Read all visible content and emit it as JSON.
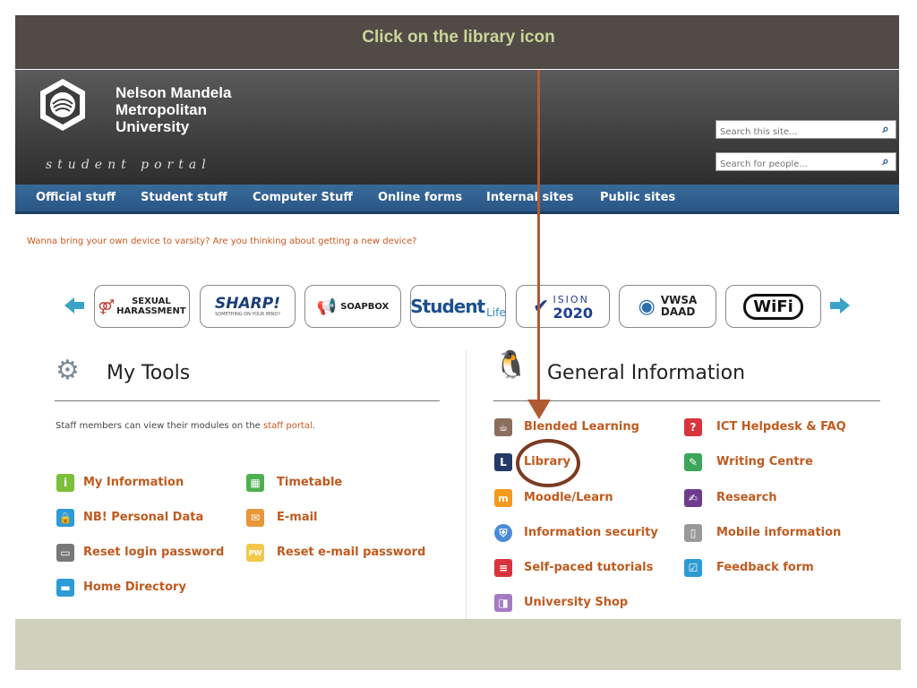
{
  "slide": {
    "instruction": "Click on the library icon",
    "accent_color": "#b05a33"
  },
  "header": {
    "university_name": [
      "Nelson Mandela",
      "Metropolitan",
      "University"
    ],
    "portal_label": "student portal",
    "search_site_placeholder": "Search this site...",
    "search_people_placeholder": "Search for people..."
  },
  "nav": {
    "items": [
      "Official stuff",
      "Student stuff",
      "Computer Stuff",
      "Online forms",
      "Internal sites",
      "Public sites"
    ]
  },
  "promo_text": "Wanna bring your own device to varsity? Are you thinking about getting a new device?",
  "banners": [
    {
      "label": "SEXUAL HARASSMENT",
      "line1": "SEXUAL",
      "line2": "HARASSMENT"
    },
    {
      "label": "SHARP!",
      "line1": "SHARP!",
      "line2": "SOMETHING ON YOUR MIND?"
    },
    {
      "label": "SOAPBOX",
      "line1": "SOAPBOX"
    },
    {
      "label": "Student Life",
      "line1": "Student",
      "line2": "Life"
    },
    {
      "label": "VISION 2020",
      "line1": "ISION",
      "line2": "2020"
    },
    {
      "label": "VWSA DAAD",
      "line1": "VWSA",
      "line2": "DAAD"
    },
    {
      "label": "WiFi",
      "line1": "WiFi"
    }
  ],
  "my_tools": {
    "title": "My Tools",
    "note_prefix": "Staff members can view their modules on the ",
    "note_link": "staff portal",
    "note_suffix": ".",
    "links": [
      {
        "label": "My Information",
        "icon": "info-icon"
      },
      {
        "label": "Timetable",
        "icon": "timetable-icon"
      },
      {
        "label": "NB! Personal Data",
        "icon": "lock-icon"
      },
      {
        "label": "E-mail",
        "icon": "envelope-icon"
      },
      {
        "label": "Reset login password",
        "icon": "monitor-icon"
      },
      {
        "label": "Reset e-mail password",
        "icon": "pw-envelope-icon"
      },
      {
        "label": "Home Directory",
        "icon": "folder-icon"
      }
    ]
  },
  "general_info": {
    "title": "General Information",
    "links": [
      {
        "label": "Blended Learning",
        "icon": "coffee-cup-icon"
      },
      {
        "label": "ICT Helpdesk & FAQ",
        "icon": "question-icon"
      },
      {
        "label": "Library",
        "icon": "library-icon"
      },
      {
        "label": "Writing Centre",
        "icon": "pencil-icon"
      },
      {
        "label": "Moodle/Learn",
        "icon": "moodle-icon"
      },
      {
        "label": "Research",
        "icon": "research-icon"
      },
      {
        "label": "Information security",
        "icon": "shield-icon"
      },
      {
        "label": "Mobile information",
        "icon": "mobile-icon"
      },
      {
        "label": "Self-paced tutorials",
        "icon": "book-icon"
      },
      {
        "label": "Feedback form",
        "icon": "checkbox-icon"
      },
      {
        "label": "University Shop",
        "icon": "shopping-bag-icon"
      }
    ]
  }
}
